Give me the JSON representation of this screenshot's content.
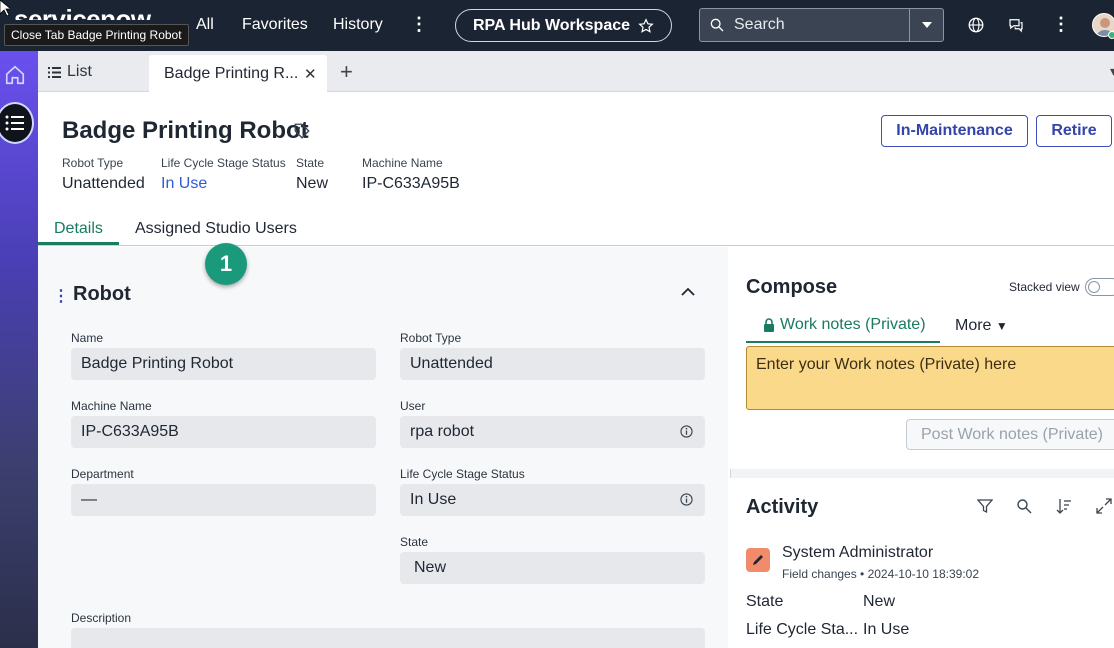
{
  "topnav": {
    "logo_text": "servicenow",
    "tooltip": "Close Tab Badge Printing Robot",
    "links": [
      "All",
      "Favorites",
      "History"
    ],
    "workspace": "RPA Hub Workspace",
    "search_placeholder": "Search"
  },
  "tabbar": {
    "list_label": "List",
    "active_tab": "Badge Printing R..."
  },
  "record": {
    "title": "Badge Printing Robot",
    "buttons": {
      "maintenance": "In-Maintenance",
      "retire": "Retire"
    },
    "meta": [
      {
        "label": "Robot Type",
        "value": "Unattended"
      },
      {
        "label": "Life Cycle Stage Status",
        "value": "In Use"
      },
      {
        "label": "State",
        "value": "New"
      },
      {
        "label": "Machine Name",
        "value": "IP-C633A95B"
      }
    ]
  },
  "detail_tabs": [
    "Details",
    "Assigned Studio Users"
  ],
  "step_badge": "1",
  "form": {
    "section_title": "Robot",
    "fields": {
      "name": {
        "label": "Name",
        "value": "Badge Printing Robot"
      },
      "robot_type": {
        "label": "Robot Type",
        "value": "Unattended"
      },
      "machine_name": {
        "label": "Machine Name",
        "value": "IP-C633A95B"
      },
      "user": {
        "label": "User",
        "value": "rpa robot"
      },
      "department": {
        "label": "Department",
        "value": "—"
      },
      "life_cycle": {
        "label": "Life Cycle Stage Status",
        "value": "In Use"
      },
      "state": {
        "label": "State",
        "value": "New"
      },
      "description": {
        "label": "Description",
        "value": ""
      }
    }
  },
  "compose": {
    "title": "Compose",
    "stacked_view": "Stacked view",
    "work_notes_tab": "Work notes (Private)",
    "more_tab": "More",
    "notes_placeholder": "Enter your Work notes (Private) here",
    "post_button": "Post Work notes (Private)"
  },
  "activity": {
    "title": "Activity",
    "user": "System Administrator",
    "meta": "Field changes • 2024-10-10 18:39:02",
    "changes": [
      {
        "field": "State",
        "value": "New"
      },
      {
        "field": "Life Cycle Sta...",
        "value": "In Use"
      }
    ]
  },
  "colors": {
    "nav_bg": "#1b2432",
    "accent_green": "#1a7a62",
    "button_blue": "#3344aa",
    "link_blue": "#2e5bd8",
    "notes_yellow": "#fbd98a"
  }
}
